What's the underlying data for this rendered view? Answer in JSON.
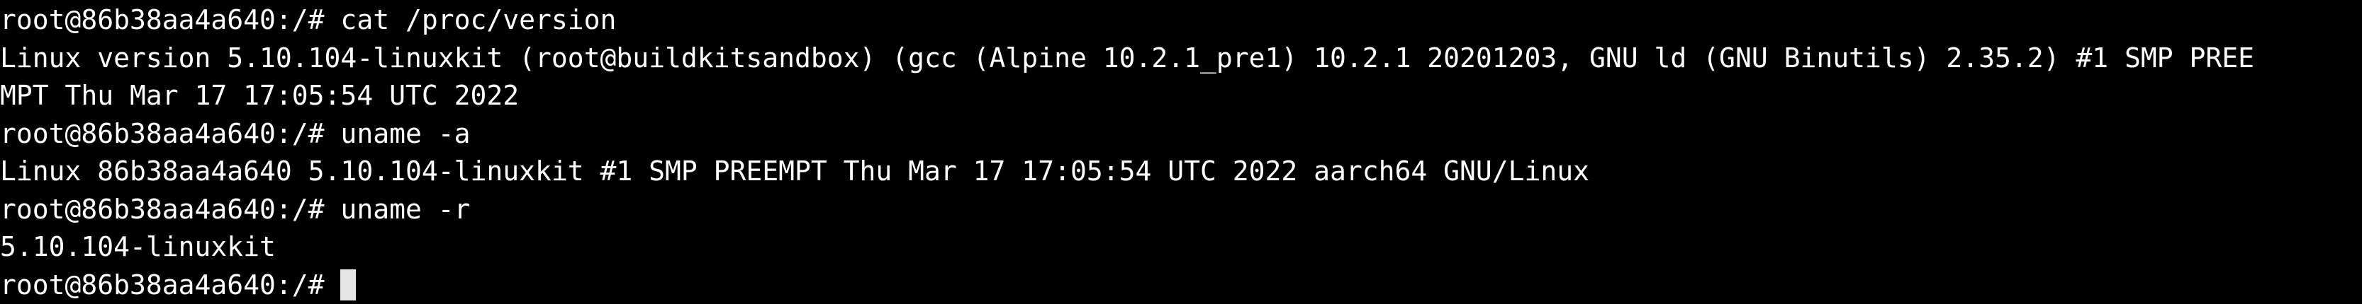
{
  "terminal": {
    "background_color": "#000000",
    "text_color": "#ffffff",
    "cursor_color": "#e6e6e6",
    "lines": [
      "root@86b38aa4a640:/# cat /proc/version",
      "Linux version 5.10.104-linuxkit (root@buildkitsandbox) (gcc (Alpine 10.2.1_pre1) 10.2.1 20201203, GNU ld (GNU Binutils) 2.35.2) #1 SMP PREE",
      "MPT Thu Mar 17 17:05:54 UTC 2022",
      "root@86b38aa4a640:/# uname -a",
      "Linux 86b38aa4a640 5.10.104-linuxkit #1 SMP PREEMPT Thu Mar 17 17:05:54 UTC 2022 aarch64 GNU/Linux",
      "root@86b38aa4a640:/# uname -r",
      "5.10.104-linuxkit"
    ],
    "current_prompt": "root@86b38aa4a640:/# "
  }
}
